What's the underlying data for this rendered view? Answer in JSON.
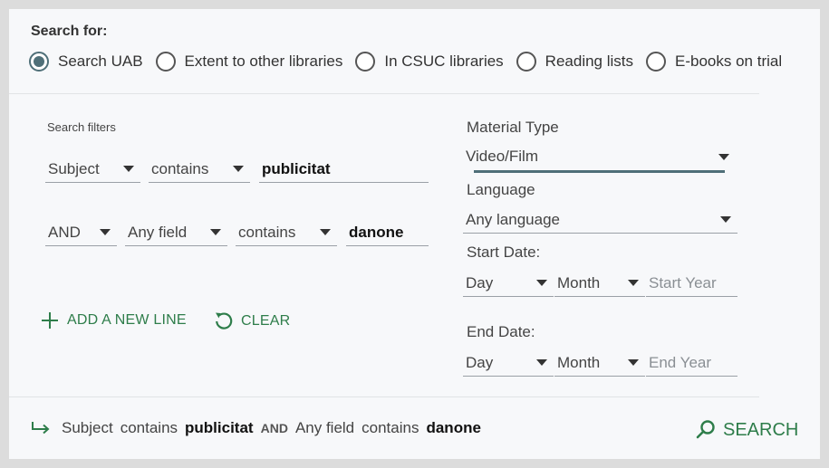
{
  "search_for": {
    "label": "Search for:",
    "scopes": [
      {
        "label": "Search UAB",
        "selected": true
      },
      {
        "label": "Extent to other libraries",
        "selected": false
      },
      {
        "label": "In CSUC libraries",
        "selected": false
      },
      {
        "label": "Reading lists",
        "selected": false
      },
      {
        "label": "E-books on trial",
        "selected": false
      }
    ]
  },
  "filters": {
    "title": "Search filters",
    "line1": {
      "field": "Subject",
      "condition": "contains",
      "value": "publicitat"
    },
    "line2": {
      "operator": "AND",
      "field": "Any field",
      "condition": "contains",
      "value": "danone"
    },
    "add_line_label": "ADD A NEW LINE",
    "clear_label": "CLEAR"
  },
  "facets": {
    "material_type": {
      "label": "Material Type",
      "value": "Video/Film"
    },
    "language": {
      "label": "Language",
      "value": "Any language"
    },
    "start_date": {
      "label": "Start Date:",
      "day": "Day",
      "month": "Month",
      "year_placeholder": "Start Year"
    },
    "end_date": {
      "label": "End Date:",
      "day": "Day",
      "month": "Month",
      "year_placeholder": "End Year"
    }
  },
  "summary": {
    "field1": "Subject",
    "cond1": "contains",
    "value1": "publicitat",
    "operator": "AND",
    "field2": "Any field",
    "cond2": "contains",
    "value2": "danone"
  },
  "search_button": {
    "label": "SEARCH"
  },
  "colors": {
    "accent_green": "#2e7d4a",
    "radio_selected": "#4f6f78",
    "underline_active": "#4f6f78"
  }
}
